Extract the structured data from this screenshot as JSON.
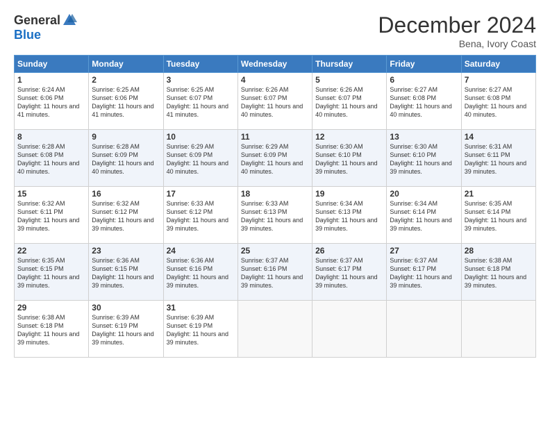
{
  "logo": {
    "general": "General",
    "blue": "Blue"
  },
  "header": {
    "month": "December 2024",
    "location": "Bena, Ivory Coast"
  },
  "days_of_week": [
    "Sunday",
    "Monday",
    "Tuesday",
    "Wednesday",
    "Thursday",
    "Friday",
    "Saturday"
  ],
  "weeks": [
    [
      {
        "day": "1",
        "sunrise": "6:24 AM",
        "sunset": "6:06 PM",
        "daylight": "11 hours and 41 minutes."
      },
      {
        "day": "2",
        "sunrise": "6:25 AM",
        "sunset": "6:06 PM",
        "daylight": "11 hours and 41 minutes."
      },
      {
        "day": "3",
        "sunrise": "6:25 AM",
        "sunset": "6:07 PM",
        "daylight": "11 hours and 41 minutes."
      },
      {
        "day": "4",
        "sunrise": "6:26 AM",
        "sunset": "6:07 PM",
        "daylight": "11 hours and 40 minutes."
      },
      {
        "day": "5",
        "sunrise": "6:26 AM",
        "sunset": "6:07 PM",
        "daylight": "11 hours and 40 minutes."
      },
      {
        "day": "6",
        "sunrise": "6:27 AM",
        "sunset": "6:08 PM",
        "daylight": "11 hours and 40 minutes."
      },
      {
        "day": "7",
        "sunrise": "6:27 AM",
        "sunset": "6:08 PM",
        "daylight": "11 hours and 40 minutes."
      }
    ],
    [
      {
        "day": "8",
        "sunrise": "6:28 AM",
        "sunset": "6:08 PM",
        "daylight": "11 hours and 40 minutes."
      },
      {
        "day": "9",
        "sunrise": "6:28 AM",
        "sunset": "6:09 PM",
        "daylight": "11 hours and 40 minutes."
      },
      {
        "day": "10",
        "sunrise": "6:29 AM",
        "sunset": "6:09 PM",
        "daylight": "11 hours and 40 minutes."
      },
      {
        "day": "11",
        "sunrise": "6:29 AM",
        "sunset": "6:09 PM",
        "daylight": "11 hours and 40 minutes."
      },
      {
        "day": "12",
        "sunrise": "6:30 AM",
        "sunset": "6:10 PM",
        "daylight": "11 hours and 39 minutes."
      },
      {
        "day": "13",
        "sunrise": "6:30 AM",
        "sunset": "6:10 PM",
        "daylight": "11 hours and 39 minutes."
      },
      {
        "day": "14",
        "sunrise": "6:31 AM",
        "sunset": "6:11 PM",
        "daylight": "11 hours and 39 minutes."
      }
    ],
    [
      {
        "day": "15",
        "sunrise": "6:32 AM",
        "sunset": "6:11 PM",
        "daylight": "11 hours and 39 minutes."
      },
      {
        "day": "16",
        "sunrise": "6:32 AM",
        "sunset": "6:12 PM",
        "daylight": "11 hours and 39 minutes."
      },
      {
        "day": "17",
        "sunrise": "6:33 AM",
        "sunset": "6:12 PM",
        "daylight": "11 hours and 39 minutes."
      },
      {
        "day": "18",
        "sunrise": "6:33 AM",
        "sunset": "6:13 PM",
        "daylight": "11 hours and 39 minutes."
      },
      {
        "day": "19",
        "sunrise": "6:34 AM",
        "sunset": "6:13 PM",
        "daylight": "11 hours and 39 minutes."
      },
      {
        "day": "20",
        "sunrise": "6:34 AM",
        "sunset": "6:14 PM",
        "daylight": "11 hours and 39 minutes."
      },
      {
        "day": "21",
        "sunrise": "6:35 AM",
        "sunset": "6:14 PM",
        "daylight": "11 hours and 39 minutes."
      }
    ],
    [
      {
        "day": "22",
        "sunrise": "6:35 AM",
        "sunset": "6:15 PM",
        "daylight": "11 hours and 39 minutes."
      },
      {
        "day": "23",
        "sunrise": "6:36 AM",
        "sunset": "6:15 PM",
        "daylight": "11 hours and 39 minutes."
      },
      {
        "day": "24",
        "sunrise": "6:36 AM",
        "sunset": "6:16 PM",
        "daylight": "11 hours and 39 minutes."
      },
      {
        "day": "25",
        "sunrise": "6:37 AM",
        "sunset": "6:16 PM",
        "daylight": "11 hours and 39 minutes."
      },
      {
        "day": "26",
        "sunrise": "6:37 AM",
        "sunset": "6:17 PM",
        "daylight": "11 hours and 39 minutes."
      },
      {
        "day": "27",
        "sunrise": "6:37 AM",
        "sunset": "6:17 PM",
        "daylight": "11 hours and 39 minutes."
      },
      {
        "day": "28",
        "sunrise": "6:38 AM",
        "sunset": "6:18 PM",
        "daylight": "11 hours and 39 minutes."
      }
    ],
    [
      {
        "day": "29",
        "sunrise": "6:38 AM",
        "sunset": "6:18 PM",
        "daylight": "11 hours and 39 minutes."
      },
      {
        "day": "30",
        "sunrise": "6:39 AM",
        "sunset": "6:19 PM",
        "daylight": "11 hours and 39 minutes."
      },
      {
        "day": "31",
        "sunrise": "6:39 AM",
        "sunset": "6:19 PM",
        "daylight": "11 hours and 39 minutes."
      },
      null,
      null,
      null,
      null
    ]
  ]
}
